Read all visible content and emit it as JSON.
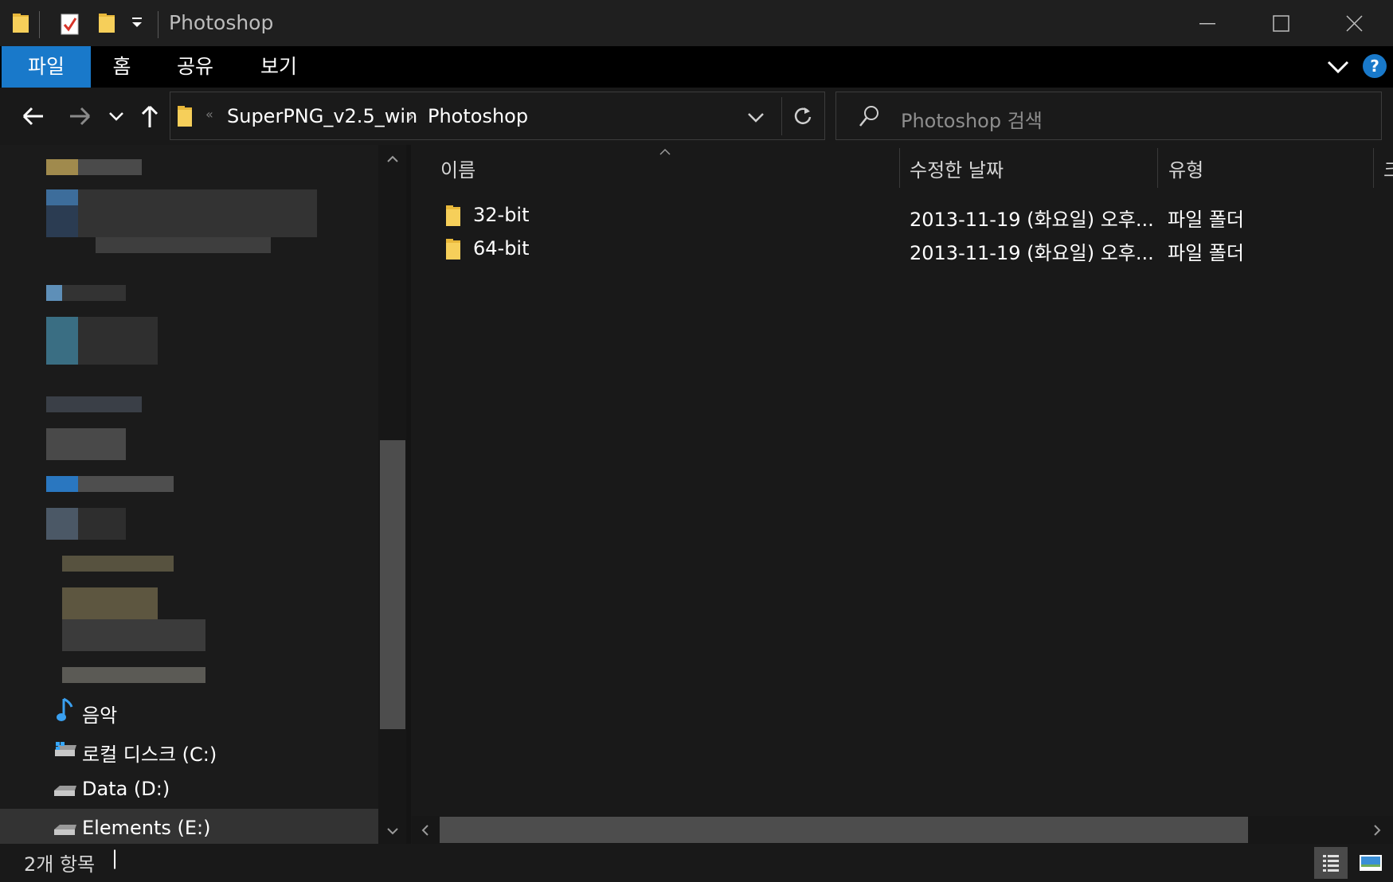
{
  "window": {
    "title": "Photoshop",
    "minimize_label": "minimize",
    "maximize_label": "maximize",
    "close_label": "close"
  },
  "ribbon": {
    "tabs": [
      "파일",
      "홈",
      "공유",
      "보기"
    ],
    "help_glyph": "?"
  },
  "address": {
    "overflow_glyph": "«",
    "breadcrumbs": [
      "SuperPNG_v2.5_win",
      "Photoshop"
    ],
    "separator": "›"
  },
  "search": {
    "placeholder": "Photoshop 검색"
  },
  "nav_pane": {
    "items": [
      {
        "label": "음악",
        "icon": "music-note-icon"
      },
      {
        "label": "로컬 디스크 (C:)",
        "icon": "windows-drive-icon"
      },
      {
        "label": "Data (D:)",
        "icon": "drive-icon"
      },
      {
        "label": "Elements (E:)",
        "icon": "drive-icon",
        "selected": true
      }
    ]
  },
  "columns": {
    "name": "이름",
    "date": "수정한 날짜",
    "type": "유형",
    "size_partial": "크"
  },
  "files": [
    {
      "name": "32-bit",
      "date": "2013-11-19 (화요일) 오후...",
      "type": "파일 폴더",
      "icon": "folder-icon"
    },
    {
      "name": "64-bit",
      "date": "2013-11-19 (화요일) 오후...",
      "type": "파일 폴더",
      "icon": "folder-icon"
    }
  ],
  "status": {
    "count": "2개 항목",
    "divider": "|"
  },
  "colors": {
    "accent": "#1979ca",
    "folder": "#f0c54a",
    "background": "#191919"
  }
}
